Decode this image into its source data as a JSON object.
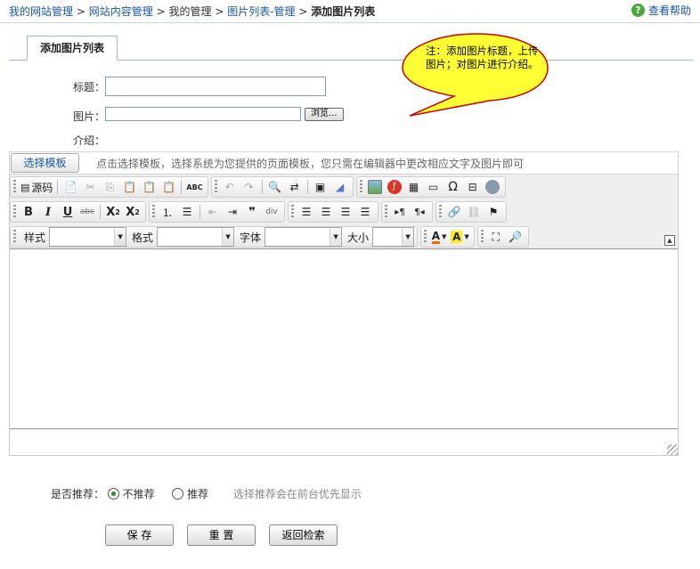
{
  "breadcrumb": {
    "items": [
      "我的网站管理",
      "网站内容管理",
      "我的管理",
      "图片列表-管理",
      "添加图片列表"
    ],
    "separator": ">"
  },
  "help": {
    "label": "查看帮助",
    "icon": "help-icon"
  },
  "tab": {
    "label": "添加图片列表"
  },
  "callout": {
    "text": "注：添加图片标题，上传图片；对图片进行介绍。",
    "fill": "#ffff33",
    "stroke": "#cc0000"
  },
  "form": {
    "title_label": "标题：",
    "title_value": "",
    "image_label": "图片：",
    "browse_label": "浏览...",
    "intro_label": "介绍："
  },
  "editor": {
    "template_button": "选择模板",
    "template_hint": "点击选择模板，选择系统为您提供的页面模板，您只需在编辑器中更改相应文字及图片即可",
    "source_label": "源码",
    "style_label": "样式",
    "format_label": "格式",
    "font_label": "字体",
    "size_label": "大小",
    "content": ""
  },
  "recommend": {
    "label": "是否推荐：",
    "options": [
      "不推荐",
      "推荐"
    ],
    "selected": "不推荐",
    "hint": "选择推荐会在前台优先显示"
  },
  "actions": {
    "save": "保 存",
    "reset": "重 置",
    "back": "返回检索"
  },
  "colors": {
    "link": "#1a56a8",
    "accent_green": "#4aa53a"
  }
}
